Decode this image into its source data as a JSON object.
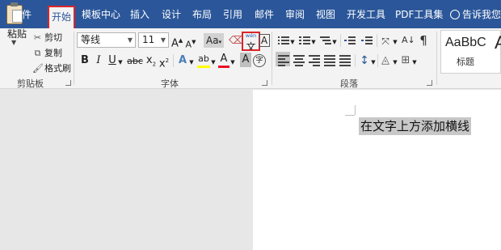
{
  "tabs": [
    "文件",
    "开始",
    "模板中心",
    "插入",
    "设计",
    "布局",
    "引用",
    "邮件",
    "审阅",
    "视图",
    "开发工具",
    "PDF工具集"
  ],
  "tell_me": "告诉我您",
  "clipboard": {
    "paste": "粘贴",
    "cut": "剪切",
    "copy": "复制",
    "format_painter": "格式刷",
    "label": "剪贴板"
  },
  "font": {
    "name": "等线",
    "size": "11",
    "grow": "A",
    "shrink": "A",
    "change_case": "Aa",
    "phonetic_pinyin": "wén",
    "phonetic_char": "文",
    "char_border": "A",
    "bold": "B",
    "italic": "I",
    "underline": "U",
    "strikethrough": "abc",
    "subscript": "x",
    "superscript": "x",
    "text_effects": "A",
    "highlight": "ab",
    "font_color": "A",
    "char_shading": "A",
    "enclose": "字",
    "label": "字体"
  },
  "paragraph": {
    "label": "段落"
  },
  "styles": {
    "sample": "AaBbC",
    "name": "标题",
    "next_sample": "A"
  },
  "document": {
    "selected_text": "在文字上方添加横线"
  }
}
